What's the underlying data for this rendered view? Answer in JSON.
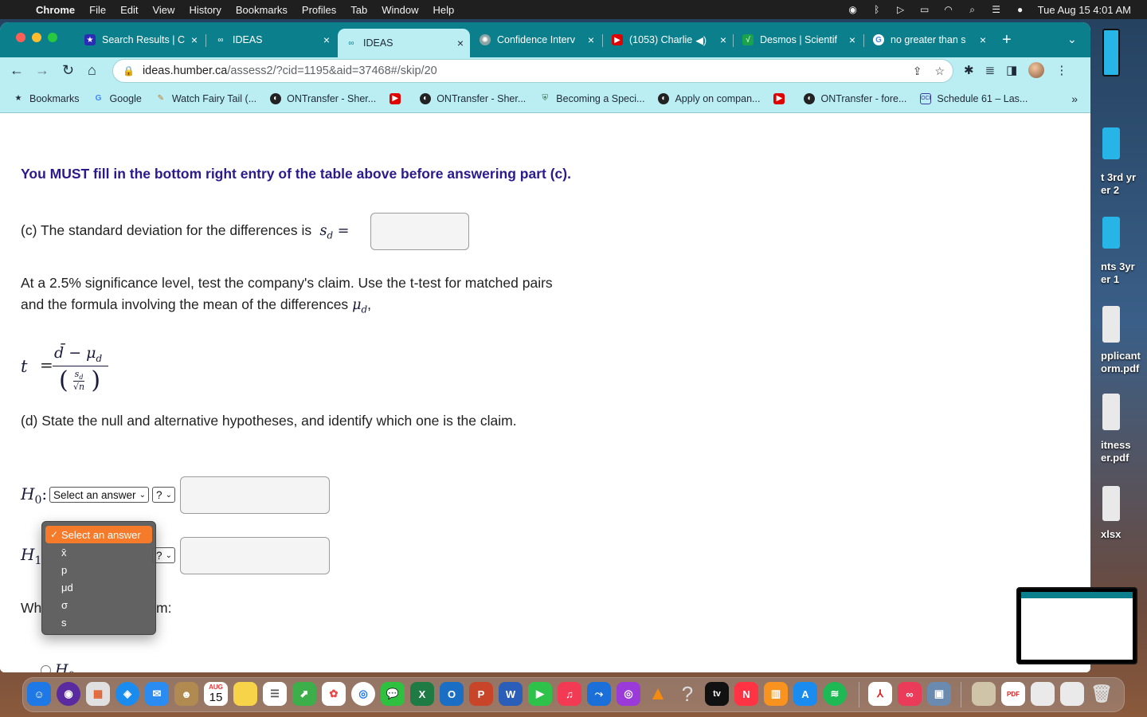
{
  "menubar": {
    "app": "Chrome",
    "items": [
      "File",
      "Edit",
      "View",
      "History",
      "Bookmarks",
      "Profiles",
      "Tab",
      "Window",
      "Help"
    ],
    "clock": "Tue Aug 15  4:01 AM"
  },
  "tabs": [
    {
      "title": "Search Results | C",
      "icon": "star-icon",
      "color": "#2b2bb5"
    },
    {
      "title": "IDEAS",
      "icon": "infinity-icon",
      "color": "#0b7f8c"
    },
    {
      "title": "IDEAS",
      "icon": "infinity-icon",
      "color": "#0b7f8c",
      "active": true
    },
    {
      "title": "Confidence Interv",
      "icon": "openai-icon",
      "color": "#7a8a8a"
    },
    {
      "title": "(1053) Charlie",
      "icon": "youtube-icon",
      "color": "#e00000"
    },
    {
      "title": "Desmos | Scientif",
      "icon": "desmos-icon",
      "color": "#1aa34a"
    },
    {
      "title": "no greater than s",
      "icon": "google-icon",
      "color": "#ffffff"
    }
  ],
  "address": {
    "host": "ideas.humber.ca",
    "path": "/assess2/?cid=1195&aid=37468#/skip/20"
  },
  "bookmarks": [
    {
      "label": "Bookmarks",
      "icon": "star-icon"
    },
    {
      "label": "Google",
      "icon": "google-icon"
    },
    {
      "label": "Watch Fairy Tail (...",
      "icon": "link-icon"
    },
    {
      "label": "ONTransfer - Sher...",
      "icon": "ontransfer-icon"
    },
    {
      "label": "",
      "icon": "youtube-icon"
    },
    {
      "label": "ONTransfer - Sher...",
      "icon": "ontransfer-icon"
    },
    {
      "label": "Becoming a Speci...",
      "icon": "shield-icon"
    },
    {
      "label": "Apply on compan...",
      "icon": "ontransfer-icon"
    },
    {
      "label": "",
      "icon": "youtube-icon"
    },
    {
      "label": "ONTransfer - fore...",
      "icon": "ontransfer-icon"
    },
    {
      "label": "Schedule 61 – Las...",
      "icon": "schedule-icon"
    }
  ],
  "question": {
    "warning": "You MUST fill in the bottom right entry of the table above before answering part (c).",
    "part_c": "(c) The standard deviation for the differences is",
    "part_c_math": "sₙ",
    "sig_text_1": "At a 2.5% significance level, test the company's claim. Use the t-test for matched pairs",
    "sig_text_2": "and the formula involving the mean of the differences",
    "formula": {
      "lhs": "t",
      "num": "d̄ − μ",
      "den_top": "s",
      "den_bot": "√n"
    },
    "part_d": "(d) State the null and alternative hypotheses, and identify which one is the claim.",
    "h0_label": "H",
    "h0_sub": "0",
    "h1_label": "H",
    "h1_sub": "1",
    "select_placeholder": "Select an answer",
    "op_placeholder": "?",
    "which_prefix": "Wh",
    "which_suffix": "m:",
    "radio_h0": "H",
    "radio_h0_sub": "0"
  },
  "dropdown": {
    "options": [
      "Select an answer",
      "x̄",
      "p",
      "μd",
      "σ",
      "s"
    ],
    "selected_index": 0
  },
  "desktop_files": [
    {
      "label": "t 3rd yr",
      "label2": "er 2"
    },
    {
      "label": "nts 3yr",
      "label2": "er 1"
    },
    {
      "label": "pplicant",
      "label2": "orm.pdf"
    },
    {
      "label": "itness",
      "label2": "er.pdf"
    },
    {
      "label": "xlsx",
      "label2": ""
    }
  ],
  "dock_badge_calendar": "15",
  "dock_month": "AUG"
}
